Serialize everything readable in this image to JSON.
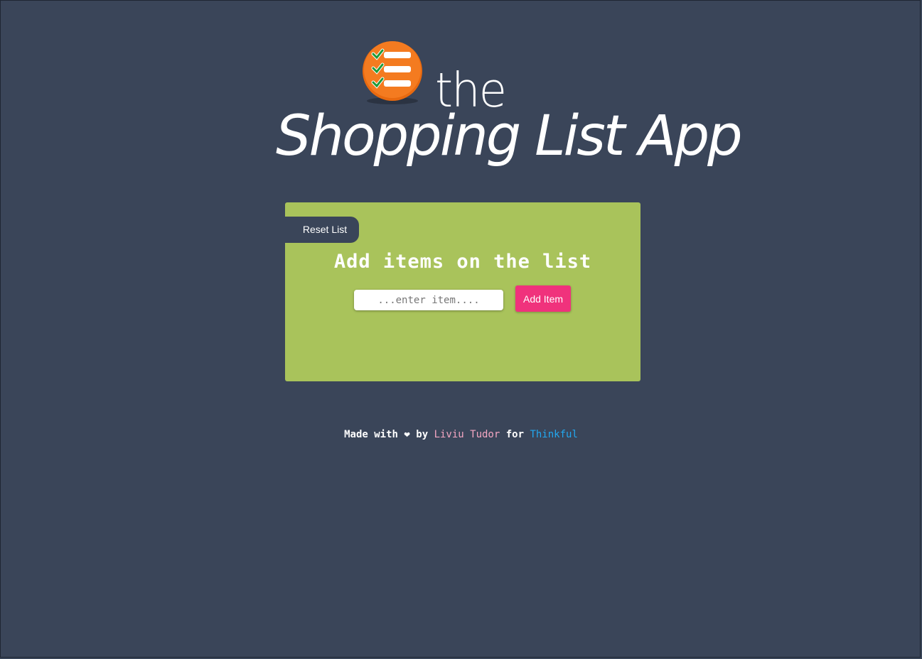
{
  "header": {
    "logo_icon": "checklist-icon",
    "title_small": "the",
    "title_big": "Shopping List App"
  },
  "panel": {
    "reset_label": "Reset List",
    "heading": "Add items on the list",
    "input_placeholder": "...enter item....",
    "input_value": "",
    "add_label": "Add Item"
  },
  "footer": {
    "made_with": "Made with",
    "heart": "❤",
    "by": "by",
    "author": "Liviu Tudor",
    "for": "for",
    "org": "Thinkful"
  },
  "colors": {
    "background": "#3a4559",
    "panel": "#a9c35b",
    "add_button": "#f0327c",
    "logo": "#f47b20",
    "author_link": "#f5a7c3",
    "org_link": "#22a8f0"
  }
}
